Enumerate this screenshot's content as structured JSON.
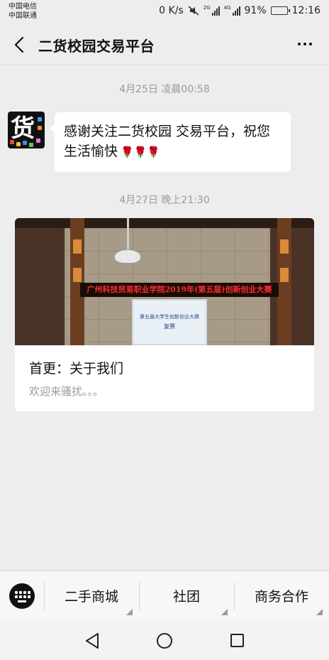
{
  "status_bar": {
    "carrier_1": "中国电信",
    "carrier_2": "中国联通",
    "speed": "0 K/s",
    "net_1": "2G",
    "net_2": "4G",
    "battery": "91%",
    "battery_level": 0.91,
    "time": "12:16"
  },
  "header": {
    "title": "二货校园交易平台"
  },
  "chat": {
    "timestamp_1": "4月25日 凌晨00:58",
    "avatar_glyph": "货",
    "message_text": "感谢关注二货校园 交易平台，祝您生活愉快",
    "roses": "🌹🌹🌹",
    "timestamp_2": "4月27日 晚上21:30",
    "article": {
      "image_banner": "广州科技贸易职业学院2019年(第五届)创新创业大赛",
      "image_screen_line1": "第五届大学生创新创业大赛",
      "image_screen_line2": "复赛",
      "title": "首更：关于我们",
      "subtitle": "欢迎来骚扰。。。"
    }
  },
  "menu": {
    "items": [
      "二手商城",
      "社团",
      "商务合作"
    ]
  },
  "colors": {
    "background": "#ededed",
    "bubble": "#ffffff",
    "timestamp": "#9a9a9a",
    "rose": "#d81e3a"
  }
}
